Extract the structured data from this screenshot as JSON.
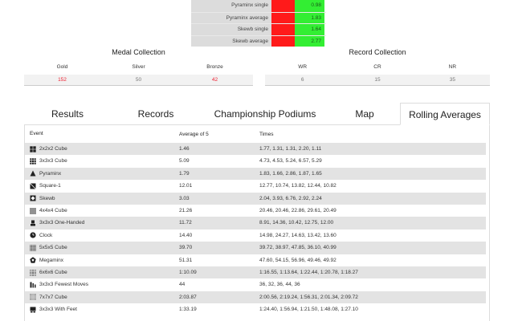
{
  "top_table": {
    "rows": [
      {
        "label": "Pyraminx single",
        "value": "0.98"
      },
      {
        "label": "Pyraminx average",
        "value": "1.83"
      },
      {
        "label": "Skewb single",
        "value": "1.64"
      },
      {
        "label": "Skewb average",
        "value": "2.77"
      }
    ]
  },
  "medal_collection": {
    "title": "Medal Collection",
    "headers": [
      "Gold",
      "Silver",
      "Bronze"
    ],
    "values": [
      "152",
      "50",
      "42"
    ]
  },
  "record_collection": {
    "title": "Record Collection",
    "headers": [
      "WR",
      "CR",
      "NR"
    ],
    "values": [
      "6",
      "15",
      "35"
    ]
  },
  "tabs": [
    {
      "label": "Results"
    },
    {
      "label": "Records"
    },
    {
      "label": "Championship Podiums"
    },
    {
      "label": "Map"
    },
    {
      "label": "Rolling Averages",
      "active": true
    }
  ],
  "table": {
    "headers": {
      "event": "Event",
      "average": "Average of 5",
      "times": "Times"
    },
    "rows": [
      {
        "icon": "cube-2x2-icon",
        "event": "2x2x2 Cube",
        "average": "1.46",
        "times": "1.77, 1.31, 1.31, 2.20, 1.11"
      },
      {
        "icon": "cube-3x3-icon",
        "event": "3x3x3 Cube",
        "average": "5.09",
        "times": "4.73, 4.53, 5.24, 6.57, 5.29"
      },
      {
        "icon": "pyraminx-icon",
        "event": "Pyraminx",
        "average": "1.79",
        "times": "1.83, 1.66, 2.86, 1.87, 1.65"
      },
      {
        "icon": "square1-icon",
        "event": "Square-1",
        "average": "12.01",
        "times": "12.77, 10.74, 13.82, 12.44, 10.82"
      },
      {
        "icon": "skewb-icon",
        "event": "Skewb",
        "average": "3.03",
        "times": "2.04, 3.93, 6.76, 2.92, 2.24"
      },
      {
        "icon": "cube-4x4-icon",
        "event": "4x4x4 Cube",
        "average": "21.26",
        "times": "20.46, 20.46, 22.86, 29.61, 20.49"
      },
      {
        "icon": "one-handed-icon",
        "event": "3x3x3 One-Handed",
        "average": "11.72",
        "times": "8.91, 14.36, 10.42, 12.75, 12.00"
      },
      {
        "icon": "clock-icon",
        "event": "Clock",
        "average": "14.40",
        "times": "14.98, 24.27, 14.63, 13.42, 13.60"
      },
      {
        "icon": "cube-5x5-icon",
        "event": "5x5x5 Cube",
        "average": "39.70",
        "times": "39.72, 38.97, 47.85, 36.10, 40.99"
      },
      {
        "icon": "megaminx-icon",
        "event": "Megaminx",
        "average": "51.31",
        "times": "47.60, 54.15, 56.96, 49.46, 49.92"
      },
      {
        "icon": "cube-6x6-icon",
        "event": "6x6x6 Cube",
        "average": "1:10.09",
        "times": "1:16.55, 1:13.64, 1:22.44, 1:20.78, 1:18.27"
      },
      {
        "icon": "fewest-moves-icon",
        "event": "3x3x3 Fewest Moves",
        "average": "44",
        "times": "36, 32, 36, 44, 36"
      },
      {
        "icon": "cube-7x7-icon",
        "event": "7x7x7 Cube",
        "average": "2:03.87",
        "times": "2:00.56, 2:19.24, 1:56.31, 2:01.34, 2:09.72"
      },
      {
        "icon": "with-feet-icon",
        "event": "3x3x3 With Feet",
        "average": "1:33.19",
        "times": "1:24.40, 1:56.94, 1:21.50, 1:48.08, 1:27.10"
      }
    ]
  }
}
